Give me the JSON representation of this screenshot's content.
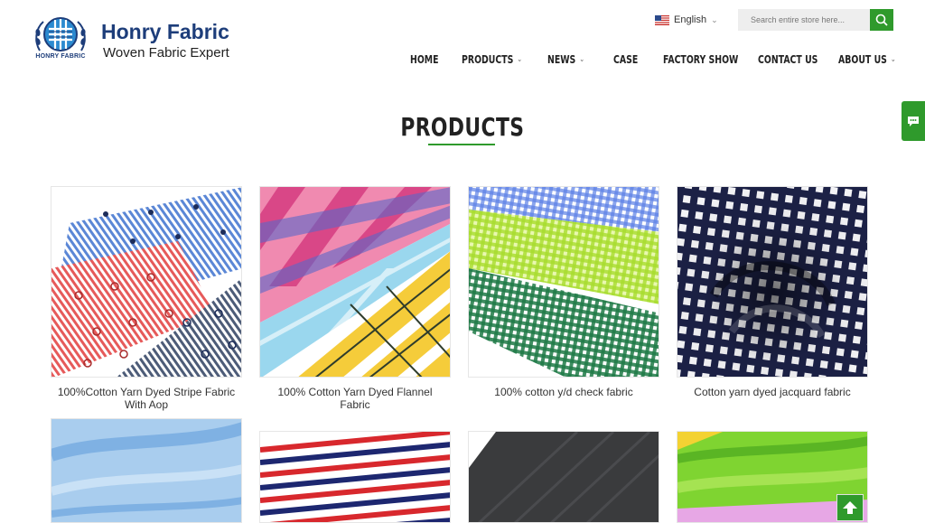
{
  "brand": {
    "name": "Honry Fabric",
    "tagline": "Woven Fabric Expert",
    "badge_text": "HONRY FABRIC",
    "primary_color": "#1d3d7a",
    "accent_color": "#2f9a2c"
  },
  "language": {
    "current": "English",
    "flag_icon": "us-flag-icon"
  },
  "search": {
    "placeholder": "Search entire store here..."
  },
  "nav": {
    "items": [
      {
        "label": "HOME",
        "dropdown": false
      },
      {
        "label": "PRODUCTS",
        "dropdown": true
      },
      {
        "label": "NEWS",
        "dropdown": true
      },
      {
        "label": "CASE",
        "dropdown": false
      },
      {
        "label": "FACTORY SHOW",
        "dropdown": false
      },
      {
        "label": "CONTACT US",
        "dropdown": false
      },
      {
        "label": "ABOUT US",
        "dropdown": true
      }
    ]
  },
  "section": {
    "title": "PRODUCTS"
  },
  "products": [
    {
      "label": "100%Cotton Yarn Dyed Stripe Fabric With Aop",
      "image": "stripe-print"
    },
    {
      "label": "100% Cotton Yarn Dyed Flannel Fabric",
      "image": "plaid-flannel"
    },
    {
      "label": "100% cotton y/d check fabric",
      "image": "gingham"
    },
    {
      "label": "Cotton yarn dyed jacquard fabric",
      "image": "jacquard-check"
    },
    {
      "label": "",
      "image": "chambray-blue"
    },
    {
      "label": "",
      "image": "red-navy-stripe"
    },
    {
      "label": "",
      "image": "black-herringbone"
    },
    {
      "label": "",
      "image": "green-stack"
    }
  ],
  "widgets": {
    "chat_icon": "chat-icon",
    "back_to_top_icon": "arrow-up-icon"
  }
}
